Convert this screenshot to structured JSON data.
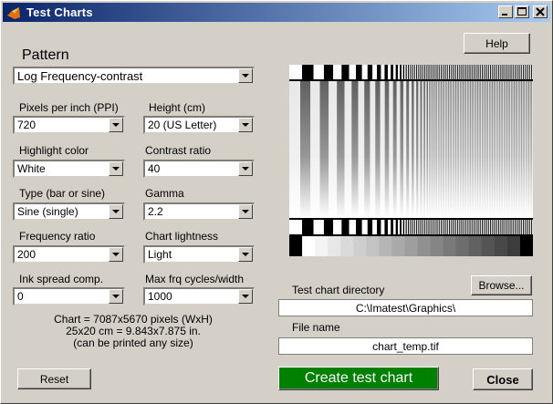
{
  "window": {
    "title": "Test Charts"
  },
  "pattern": {
    "label": "Pattern",
    "value": "Log Frequency-contrast"
  },
  "fields": {
    "ppi": {
      "label": "Pixels per inch (PPI)",
      "value": "720"
    },
    "height": {
      "label": "Height (cm)",
      "value": "20 (US Letter)"
    },
    "highlight": {
      "label": "Highlight color",
      "value": "White"
    },
    "contrast": {
      "label": "Contrast ratio",
      "value": "40"
    },
    "type": {
      "label": "Type (bar or sine)",
      "value": "Sine (single)"
    },
    "gamma": {
      "label": "Gamma",
      "value": "2.2"
    },
    "freq_ratio": {
      "label": "Frequency ratio",
      "value": "200"
    },
    "lightness": {
      "label": "Chart lightness",
      "value": "Light"
    },
    "ink": {
      "label": "Ink spread comp.",
      "value": "0"
    },
    "maxfrq": {
      "label": "Max frq cycles/width",
      "value": "1000"
    }
  },
  "info": {
    "line1": "Chart = 7087x5670 pixels (WxH)",
    "line2": "25x20 cm = 9.843x7.875 in.",
    "line3": "(can be printed any size)"
  },
  "directory": {
    "label": "Test chart directory",
    "value": "C:\\Imatest\\Graphics\\",
    "browse_label": "Browse..."
  },
  "filename": {
    "label": "File name",
    "value": "chart_temp.tif"
  },
  "buttons": {
    "help": "Help",
    "reset": "Reset",
    "create": "Create test chart",
    "close": "Close"
  },
  "colors": {
    "titlebar_start": "#0a246a",
    "titlebar_end": "#a6caf0",
    "create_button": "#008000",
    "face": "#d4d0c8"
  },
  "icons": {
    "app": "matlab-icon",
    "minimize": "minimize-icon",
    "maximize": "maximize-icon",
    "close": "close-icon",
    "dropdown": "chevron-down-icon"
  }
}
